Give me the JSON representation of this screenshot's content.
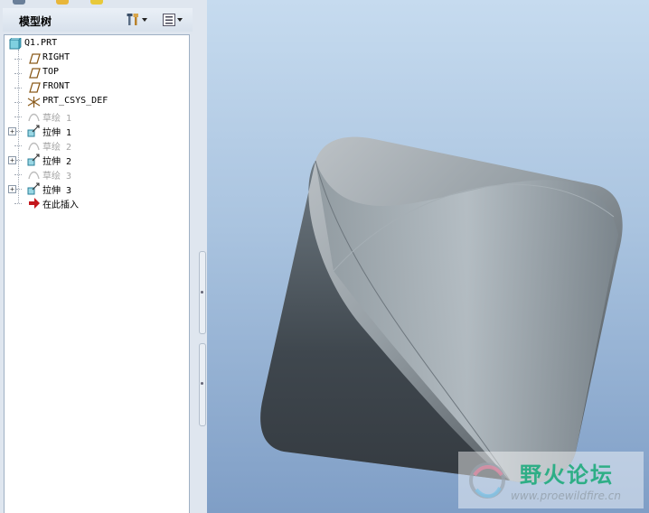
{
  "panel": {
    "title": "模型树",
    "settings_icon": "tools-icon",
    "show_icon": "list-icon"
  },
  "tree": {
    "items": [
      {
        "label": "Q1.PRT",
        "icon": "part-icon",
        "expandable": false,
        "dimmed": false
      },
      {
        "label": "RIGHT",
        "icon": "datum-plane-icon",
        "expandable": false,
        "dimmed": false
      },
      {
        "label": "TOP",
        "icon": "datum-plane-icon",
        "expandable": false,
        "dimmed": false
      },
      {
        "label": "FRONT",
        "icon": "datum-plane-icon",
        "expandable": false,
        "dimmed": false
      },
      {
        "label": "PRT_CSYS_DEF",
        "icon": "csys-icon",
        "expandable": false,
        "dimmed": false
      },
      {
        "label": "草绘 1",
        "icon": "sketch-icon",
        "expandable": false,
        "dimmed": true
      },
      {
        "label": "拉伸 1",
        "icon": "extrude-icon",
        "expandable": true,
        "dimmed": false
      },
      {
        "label": "草绘 2",
        "icon": "sketch-icon",
        "expandable": false,
        "dimmed": true
      },
      {
        "label": "拉伸 2",
        "icon": "extrude-icon",
        "expandable": true,
        "dimmed": false
      },
      {
        "label": "草绘 3",
        "icon": "sketch-icon",
        "expandable": false,
        "dimmed": true
      },
      {
        "label": "拉伸 3",
        "icon": "extrude-icon",
        "expandable": true,
        "dimmed": false
      },
      {
        "label": "在此插入",
        "icon": "insert-arrow-icon",
        "expandable": false,
        "dimmed": false
      }
    ]
  },
  "watermark": {
    "title": "野火论坛",
    "url": "www.proewildfire.cn"
  },
  "colors": {
    "viewport_top": "#c6dbef",
    "viewport_bottom": "#7f9ec6",
    "model_surface": "#8e979e",
    "watermark_text": "#2eae86"
  }
}
